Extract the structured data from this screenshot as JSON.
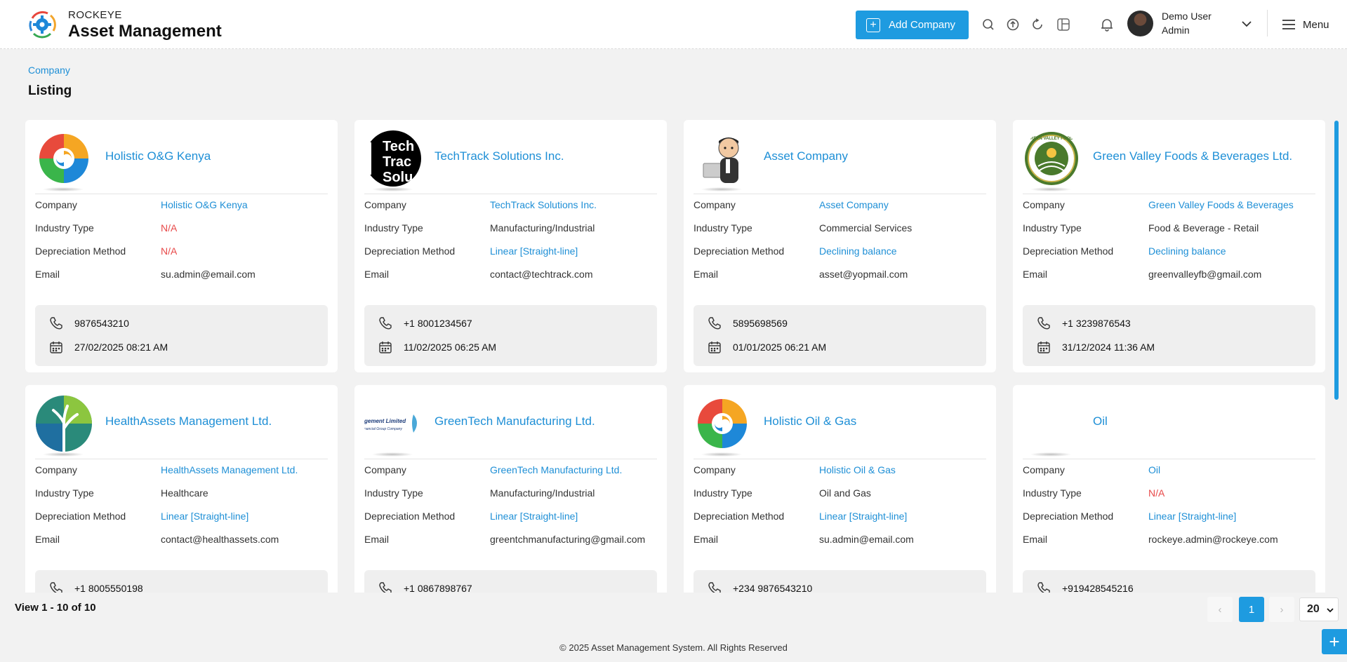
{
  "header": {
    "brand_small": "ROCKEYE",
    "brand_big": "Asset Management",
    "add_button": "Add Company",
    "user_name": "Demo User",
    "user_role": "Admin",
    "menu_label": "Menu",
    "icons": [
      "search-icon",
      "upload-icon",
      "refresh-icon",
      "columns-icon",
      "bell-icon",
      "chevron-down-icon",
      "hamburger-icon"
    ]
  },
  "breadcrumb": "Company",
  "page_title": "Listing",
  "labels": {
    "company": "Company",
    "industry": "Industry Type",
    "depreciation": "Depreciation Method",
    "email": "Email"
  },
  "cards": [
    {
      "name": "Holistic O&G Kenya",
      "company": "Holistic O&G Kenya",
      "industry": "N/A",
      "depreciation": "N/A",
      "email": "su.admin@email.com",
      "phone": "9876543210",
      "date": "27/02/2025 08:21 AM"
    },
    {
      "name": "TechTrack Solutions Inc.",
      "company": "TechTrack Solutions Inc.",
      "industry": "Manufacturing/Industrial",
      "depreciation": "Linear [Straight-line]",
      "email": "contact@techtrack.com",
      "phone": "+1 8001234567",
      "date": "11/02/2025 06:25 AM",
      "logo_text": [
        "Tech",
        "Trac",
        "Solu"
      ]
    },
    {
      "name": "Asset Company",
      "company": "Asset Company",
      "industry": "Commercial Services",
      "depreciation": "Declining balance",
      "email": "asset@yopmail.com",
      "phone": "5895698569",
      "date": "01/01/2025 06:21 AM"
    },
    {
      "name": "Green Valley Foods & Beverages Ltd.",
      "company": "Green Valley Foods & Beverages",
      "industry": "Food & Beverage - Retail",
      "depreciation": "Declining balance",
      "email": "greenvalleyfb@gmail.com",
      "phone": "+1 3239876543",
      "date": "31/12/2024 11:36 AM",
      "logo_text": "GREEN VALLEY FOODS"
    },
    {
      "name": "HealthAssets Management Ltd.",
      "company": "HealthAssets Management Ltd.",
      "industry": "Healthcare",
      "depreciation": "Linear [Straight-line]",
      "email": "contact@healthassets.com",
      "phone": "+1 8005550198",
      "date": ""
    },
    {
      "name": "GreenTech Manufacturing Ltd.",
      "company": "GreenTech Manufacturing Ltd.",
      "industry": "Manufacturing/Industrial",
      "depreciation": "Linear [Straight-line]",
      "email": "greentchmanufacturing@gmail.com",
      "phone": "+1 0867898767",
      "date": "",
      "logo_text": [
        "gement Limited",
        "nancial Group Company"
      ]
    },
    {
      "name": "Holistic Oil & Gas",
      "company": "Holistic Oil & Gas",
      "industry": "Oil and Gas",
      "depreciation": "Linear [Straight-line]",
      "email": "su.admin@email.com",
      "phone": "+234 9876543210",
      "date": ""
    },
    {
      "name": "Oil",
      "company": "Oil",
      "industry": "N/A",
      "depreciation": "Linear [Straight-line]",
      "email": "rockeye.admin@rockeye.com",
      "phone": "+919428545216",
      "date": ""
    }
  ],
  "pagination": {
    "view_text": "View 1 - 10 of 10",
    "prev": "‹",
    "current_page": "1",
    "next": "›",
    "page_size": "20"
  },
  "footer": {
    "copyright": "© 2025 Asset Management System. All Rights Reserved"
  },
  "colors": {
    "accent": "#1e9be0",
    "link": "#1e8fd6",
    "na": "#e84a4a",
    "background": "#f2f2f2"
  }
}
